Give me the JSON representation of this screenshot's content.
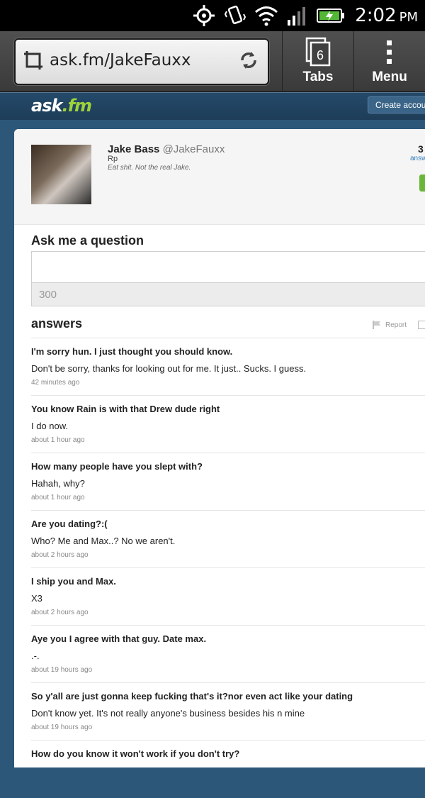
{
  "status_bar": {
    "time": "2:02",
    "ampm": "PM",
    "icons": [
      "gps-icon",
      "vibrate-icon",
      "wifi-icon",
      "signal-icon",
      "battery-charging-icon"
    ]
  },
  "browser": {
    "url": "ask.fm/JakeFauxx",
    "tabs_count": "6",
    "tabs_label": "Tabs",
    "menu_label": "Menu"
  },
  "site": {
    "logo_main": "ask",
    "logo_accent": ".fm",
    "create_account": "Create accoun"
  },
  "profile": {
    "name": "Jake Bass",
    "handle": "@JakeFauxx",
    "role": "Rp",
    "bio": "Eat shit. Not the real Jake.",
    "stat_number": "3",
    "stat_label": "answ"
  },
  "ask_box": {
    "title": "Ask me a question",
    "char_count": "300"
  },
  "answers_section": {
    "title": "answers",
    "report_label": "Report"
  },
  "answers": [
    {
      "question": "I'm sorry hun. I just thought you should know.",
      "answer": "Don't be sorry, thanks for looking out for me. It just.. Sucks. I guess.",
      "time": "42 minutes ago"
    },
    {
      "question": "You know Rain is with that Drew dude right",
      "answer": "I do now.",
      "time": "about 1 hour ago"
    },
    {
      "question": "How many people have you slept with?",
      "answer": "Hahah, why?",
      "time": "about 1 hour ago"
    },
    {
      "question": "Are you dating?:(",
      "answer": "Who? Me and Max..? No we aren't.",
      "time": "about 2 hours ago"
    },
    {
      "question": "I ship you and Max.",
      "answer": "X3",
      "time": "about 2 hours ago"
    },
    {
      "question": "Aye you I agree with that guy. Date max.",
      "answer": ".-.",
      "time": "about 19 hours ago"
    },
    {
      "question": "So y'all are just gonna keep fucking that's it?nor even act like your dating",
      "answer": "Don't know yet. It's not really anyone's business besides his n mine",
      "time": "about 19 hours ago"
    },
    {
      "question": "How do you know it won't work if you don't try?",
      "answer": "",
      "time": ""
    }
  ]
}
